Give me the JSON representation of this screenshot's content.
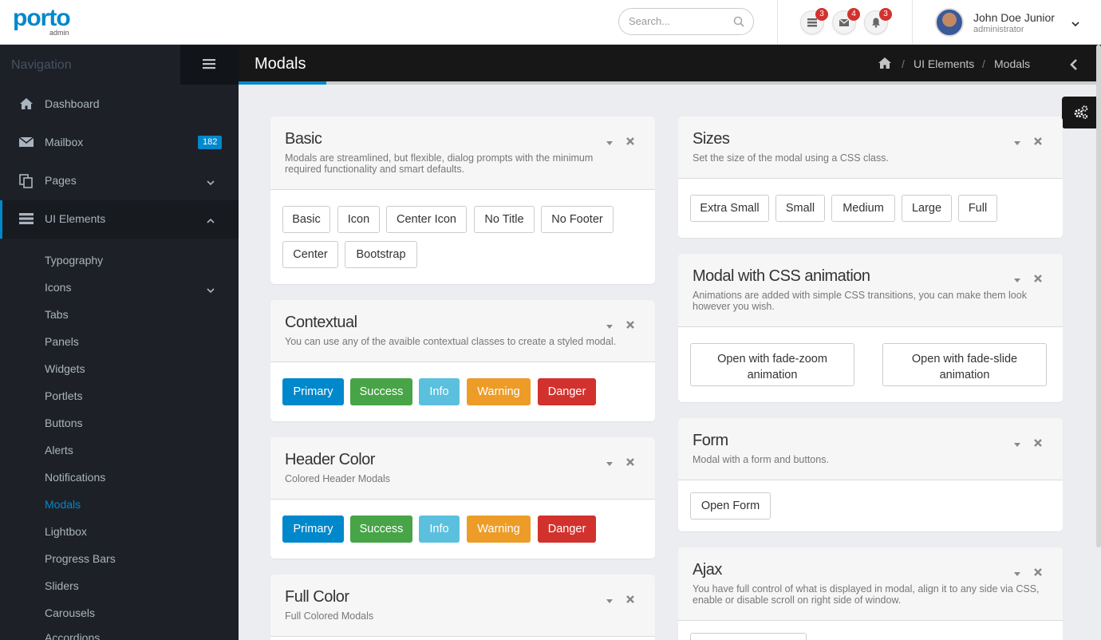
{
  "header": {
    "logo_main": "porto",
    "logo_sub": "admin",
    "search_placeholder": "Search...",
    "notifications": [
      {
        "icon": "tasks-icon",
        "count": "3"
      },
      {
        "icon": "envelope-icon",
        "count": "4"
      },
      {
        "icon": "bell-icon",
        "count": "3"
      }
    ],
    "user_name": "John Doe Junior",
    "user_role": "administrator"
  },
  "sidebar": {
    "title": "Navigation",
    "items": [
      {
        "label": "Dashboard",
        "icon": "home-icon"
      },
      {
        "label": "Mailbox",
        "icon": "envelope-icon",
        "badge": "182"
      },
      {
        "label": "Pages",
        "icon": "copy-icon"
      },
      {
        "label": "UI Elements",
        "icon": "tasks-icon"
      }
    ],
    "sub_items": [
      "Typography",
      "Icons",
      "Tabs",
      "Panels",
      "Widgets",
      "Portlets",
      "Buttons",
      "Alerts",
      "Notifications",
      "Modals",
      "Lightbox",
      "Progress Bars",
      "Sliders",
      "Carousels",
      "Accordions"
    ],
    "current": "Modals"
  },
  "page": {
    "title": "Modals",
    "breadcrumbs": [
      "UI Elements",
      "Modals"
    ],
    "crumb_sep": "/"
  },
  "cards": {
    "basic": {
      "title": "Basic",
      "subtitle_l1": "Modals are streamlined, but flexible, dialog prompts with the minimum",
      "subtitle_l2": "required functionality and smart defaults.",
      "buttons": [
        "Basic",
        "Icon",
        "Center Icon",
        "No Title",
        "No Footer",
        "Center",
        "Bootstrap"
      ]
    },
    "contextual": {
      "title": "Contextual",
      "subtitle": "You can use any of the avaible contextual classes to create a styled modal.",
      "buttons": [
        "Primary",
        "Success",
        "Info",
        "Warning",
        "Danger"
      ]
    },
    "header_color": {
      "title": "Header Color",
      "subtitle": "Colored Header Modals",
      "buttons": [
        "Primary",
        "Success",
        "Info",
        "Warning",
        "Danger"
      ]
    },
    "full_color": {
      "title": "Full Color",
      "subtitle": "Full Colored Modals"
    },
    "sizes": {
      "title": "Sizes",
      "subtitle": "Set the size of the modal using a CSS class.",
      "buttons": [
        "Extra Small",
        "Small",
        "Medium",
        "Large",
        "Full"
      ]
    },
    "animation": {
      "title": "Modal with CSS animation",
      "subtitle_l1": "Animations are added with simple CSS transitions, you can make them look",
      "subtitle_l2": "however you wish.",
      "buttons": [
        {
          "l1": "Open with fade-zoom",
          "l2": "animation"
        },
        {
          "l1": "Open with fade-slide",
          "l2": "animation"
        }
      ]
    },
    "form": {
      "title": "Form",
      "subtitle": "Modal with a form and buttons.",
      "button": "Open Form"
    },
    "ajax": {
      "title": "Ajax",
      "subtitle_l1": "You have full control of what is displayed in modal, align it to any side via CSS,",
      "subtitle_l2": "enable or disable scroll on right side of window."
    }
  },
  "colors": {
    "accent": "#0088cc",
    "primary": "#0088cc",
    "success": "#47a447",
    "info": "#5bc0de",
    "warning": "#ed9c28",
    "danger": "#d2322d",
    "sidebar_bg": "#1d2127",
    "page_header_bg": "#171717"
  }
}
